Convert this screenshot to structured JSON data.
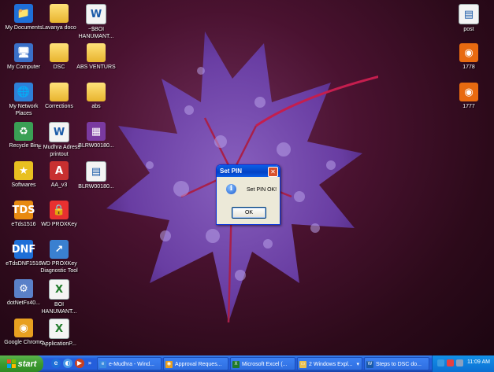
{
  "desktop": {
    "icons": [
      {
        "label": "My Documents",
        "glyph": "📁"
      },
      {
        "label": "Lavanya doco",
        "glyph": ""
      },
      {
        "label": "~$BOI HANUMANT...",
        "glyph": "W"
      },
      {
        "label": "My Computer",
        "glyph": "🖥"
      },
      {
        "label": "DSC",
        "glyph": ""
      },
      {
        "label": "ABS VENTURS",
        "glyph": ""
      },
      {
        "label": "My Network Places",
        "glyph": "🌐"
      },
      {
        "label": "Corrections",
        "glyph": ""
      },
      {
        "label": "abs",
        "glyph": ""
      },
      {
        "label": "Recycle Bin",
        "glyph": "♻"
      },
      {
        "label": "E Mudhra Adress printout",
        "glyph": "W"
      },
      {
        "label": "BLRW00180...",
        "glyph": "▦"
      },
      {
        "label": "Softwares",
        "glyph": "★"
      },
      {
        "label": "AA_v3",
        "glyph": "A"
      },
      {
        "label": "BLRW00180...",
        "glyph": "▤"
      },
      {
        "label": "eTds1516",
        "glyph": "TDS"
      },
      {
        "label": "WD PROXKey",
        "glyph": "🔒"
      },
      {
        "label": "eTdsDNF1516",
        "glyph": "DNF"
      },
      {
        "label": "WD PROXKey Diagnostic Tool",
        "glyph": "↗"
      },
      {
        "label": "dotNetFx40...",
        "glyph": "⚙"
      },
      {
        "label": "BOI HANUMANT...",
        "glyph": "X"
      },
      {
        "label": "Google Chrome",
        "glyph": "◉"
      },
      {
        "label": "ApplicationP...",
        "glyph": "X"
      }
    ],
    "right_icons": [
      {
        "label": "post",
        "glyph": "▤"
      },
      {
        "label": "1778",
        "glyph": "◉"
      },
      {
        "label": "1777",
        "glyph": "◉"
      }
    ]
  },
  "dialog": {
    "title": "Set PIN",
    "close_glyph": "✕",
    "info_glyph": "i",
    "message": "Set PIN OK!",
    "ok_label": "OK"
  },
  "taskbar": {
    "start_label": "start",
    "quicklaunch_more": "»",
    "buttons": [
      {
        "label": "e-Mudhra - Wind...",
        "glyph": "e"
      },
      {
        "label": "Approval Reques...",
        "glyph": "◉"
      },
      {
        "label": "Microsoft Excel (...",
        "glyph": "X"
      },
      {
        "label": "2 Windows Expl...",
        "glyph": "▭",
        "dropdown": "▾"
      },
      {
        "label": "Steps to DSC do...",
        "glyph": "W"
      }
    ],
    "clock": "11:09 AM"
  }
}
